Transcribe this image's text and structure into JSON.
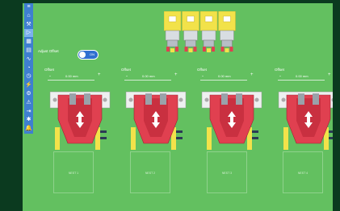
{
  "sidebar": {
    "items": [
      {
        "icon": "menu-icon",
        "glyph": "≡"
      },
      {
        "icon": "home-icon",
        "glyph": "⌂"
      },
      {
        "icon": "tool-icon",
        "glyph": "⚒"
      },
      {
        "icon": "play-icon",
        "glyph": "▷"
      },
      {
        "icon": "grid-icon",
        "glyph": "▦"
      },
      {
        "icon": "print-icon",
        "glyph": "▤"
      },
      {
        "icon": "chart-icon",
        "glyph": "∿"
      },
      {
        "icon": "gauge-icon",
        "glyph": "◔"
      },
      {
        "icon": "clock-icon",
        "glyph": "◷"
      },
      {
        "icon": "bolt-icon",
        "glyph": "⚡"
      },
      {
        "icon": "gear-icon",
        "glyph": "⚙"
      },
      {
        "icon": "warning-icon",
        "glyph": "⚠"
      },
      {
        "icon": "export-icon",
        "glyph": "⇥"
      },
      {
        "icon": "settings-icon",
        "glyph": "✱"
      },
      {
        "icon": "bell-icon",
        "glyph": "🔔"
      }
    ],
    "active_index": 3
  },
  "adjust_offset": {
    "label": "Adjust Offset",
    "state": "ON"
  },
  "offsets": [
    {
      "label": "Offset",
      "minus": "-",
      "value": "0.00 mm",
      "plus": "+"
    },
    {
      "label": "Offset",
      "minus": "-",
      "value": "0.00 mm",
      "plus": "+"
    },
    {
      "label": "Offset",
      "minus": "-",
      "value": "0.00 mm",
      "plus": "+"
    },
    {
      "label": "Offset",
      "minus": "-",
      "value": "0.00 mm",
      "plus": "+"
    }
  ],
  "slots": [
    {
      "label": "NEST 1"
    },
    {
      "label": "NEST 2"
    },
    {
      "label": "NEST 3"
    },
    {
      "label": "NEST 4"
    }
  ],
  "colors": {
    "background": "#63c060",
    "sidebar": "#3e7fd0",
    "gripper_red": "#e04050",
    "unit_yellow": "#f2e24a"
  }
}
